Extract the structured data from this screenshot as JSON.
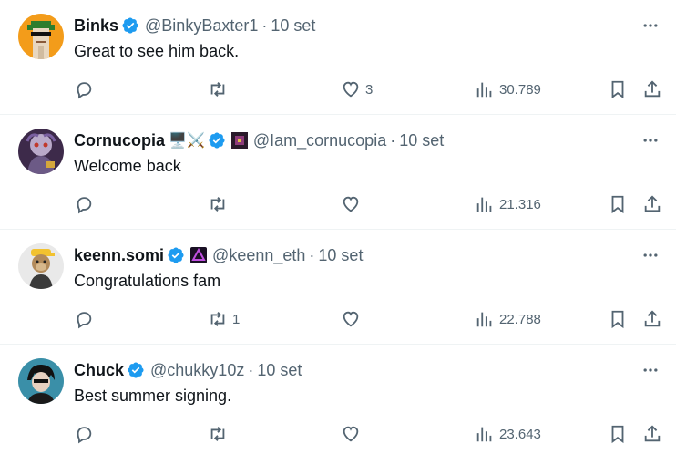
{
  "tweets": [
    {
      "name": "Binks",
      "emojis": "",
      "handle": "@BinkyBaxter1",
      "time": "10 set",
      "text": "Great to see him back.",
      "replies": "",
      "retweets": "",
      "likes": "3",
      "views": "30.789",
      "avatar_icon": "pixel-punk-avatar",
      "avatar_bg": "#f39c1a"
    },
    {
      "name": "Cornucopia",
      "emojis": "🖥️⚔️",
      "handle": "@Iam_cornucopia",
      "time": "10 set",
      "text": "Welcome back",
      "replies": "",
      "retweets": "",
      "likes": "",
      "views": "21.316",
      "avatar_icon": "creature-avatar",
      "avatar_bg": "#3d2a4a"
    },
    {
      "name": "keenn.somi",
      "emojis": "",
      "handle": "@keenn_eth",
      "time": "10 set",
      "text": "Congratulations fam",
      "replies": "",
      "retweets": "1",
      "likes": "",
      "views": "22.788",
      "avatar_icon": "ape-avatar",
      "avatar_bg": "#e9e9e9"
    },
    {
      "name": "Chuck",
      "emojis": "",
      "handle": "@chukky10z",
      "time": "10 set",
      "text": "Best summer signing.",
      "replies": "",
      "retweets": "",
      "likes": "",
      "views": "23.643",
      "avatar_icon": "anime-avatar",
      "avatar_bg": "#3a8fa8"
    }
  ],
  "colors": {
    "verified": "#1d9bf0",
    "muted": "#536471",
    "text": "#0f1419",
    "divider": "#eff3f4"
  }
}
